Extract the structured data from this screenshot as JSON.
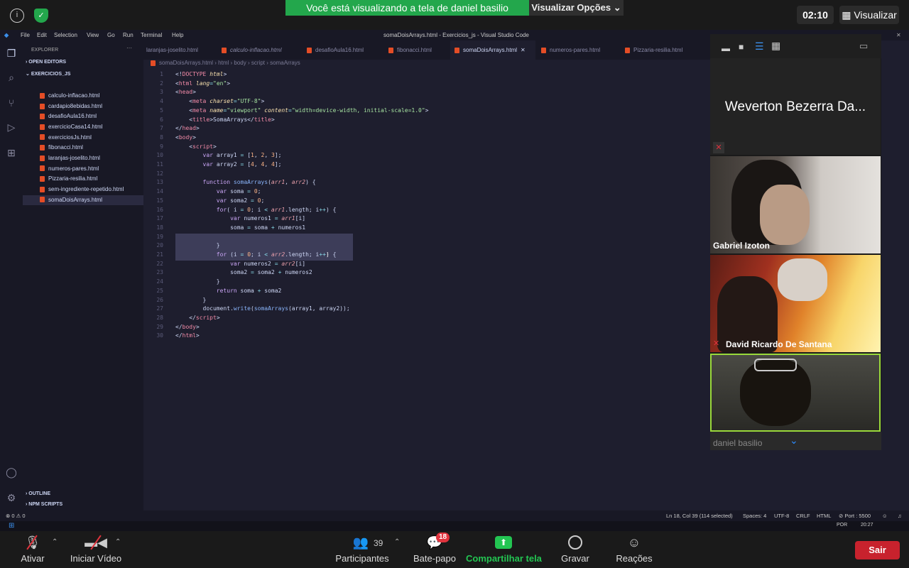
{
  "zoom": {
    "share_banner": "Você está visualizando a tela de daniel basilio",
    "view_options": "Visualizar Opções ⌄",
    "clock": "02:10",
    "view_button": "Visualizar"
  },
  "vscode": {
    "menu": [
      "File",
      "Edit",
      "Selection",
      "View",
      "Go",
      "Run",
      "Terminal",
      "Help"
    ],
    "window_title": "somaDoisArrays.html - Exercicios_js - Visual Studio Code",
    "explorer_title": "EXPLORER",
    "open_editors": "OPEN EDITORS",
    "folder": "EXERCICIOS_JS",
    "files": [
      "calculo-inflacao.html",
      "cardapio8ebidas.html",
      "desafioAula16.html",
      "exercicioCasa14.html",
      "exerciciosJs.html",
      "fibonacci.html",
      "laranjas-joselito.html",
      "numeros-pares.html",
      "Pizzaria-resilia.html",
      "sem-ingrediente-repetido.html",
      "somaDoisArrays.html"
    ],
    "outline": "OUTLINE",
    "npm": "NPM SCRIPTS",
    "tabs": [
      "laranjas-joselito.html",
      "calculo-inflacao.html",
      "desafioAula16.html",
      "fibonacci.html",
      "somaDoisArrays.html",
      "numeros-pares.html",
      "Pizzaria-resilia.html"
    ],
    "breadcrumbs": [
      "somaDoisArrays.html",
      "html",
      "body",
      "script",
      "somaArrays"
    ],
    "line_numbers": [
      "1",
      "2",
      "3",
      "4",
      "5",
      "6",
      "7",
      "8",
      "9",
      "10",
      "11",
      "12",
      "13",
      "14",
      "15",
      "16",
      "17",
      "18",
      "19",
      "20",
      "21",
      "22",
      "23",
      "24",
      "25",
      "26",
      "27",
      "28",
      "29",
      "30"
    ],
    "status": {
      "problems": "⊗ 0 ⚠ 0",
      "position": "Ln 18, Col 39 (114 selected)",
      "spaces": "Spaces: 4",
      "encoding": "UTF-8",
      "eol": "CRLF",
      "lang": "HTML",
      "port": "⊘ Port : 5500"
    }
  },
  "participants_panel": {
    "tiles": [
      {
        "name": "Weverton Bezerra Da...",
        "muted": true
      },
      {
        "name": "Gabriel Izoton",
        "muted": false
      },
      {
        "name": "David Ricardo De Santana",
        "muted": true
      },
      {
        "name": "daniel basilio",
        "muted": false
      }
    ]
  },
  "taskbar": {
    "lang": "POR",
    "time": "20:27"
  },
  "zoom_controls": {
    "mute": "Ativar",
    "video": "Iniciar Vídeo",
    "participants": "Participantes",
    "participants_count": "39",
    "chat": "Bate-papo",
    "chat_badge": "18",
    "share": "Compartilhar tela",
    "record": "Gravar",
    "reactions": "Reações",
    "leave": "Sair"
  }
}
